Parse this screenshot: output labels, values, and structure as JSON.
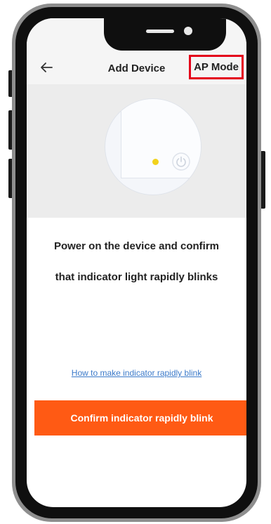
{
  "header": {
    "title": "Add Device",
    "mode_label": "AP Mode",
    "back_icon": "back-arrow-icon"
  },
  "illustration": {
    "indicator_color": "#f2d21c",
    "power_icon": "power-icon"
  },
  "instruction": {
    "line1": "Power on the device and confirm",
    "line2": "that indicator light rapidly blinks"
  },
  "help_link": "How to make indicator rapidly blink",
  "confirm_button": "Confirm indicator rapidly blink",
  "colors": {
    "accent": "#ff5a14",
    "link": "#3b7ac9",
    "highlight": "#e4001b"
  }
}
